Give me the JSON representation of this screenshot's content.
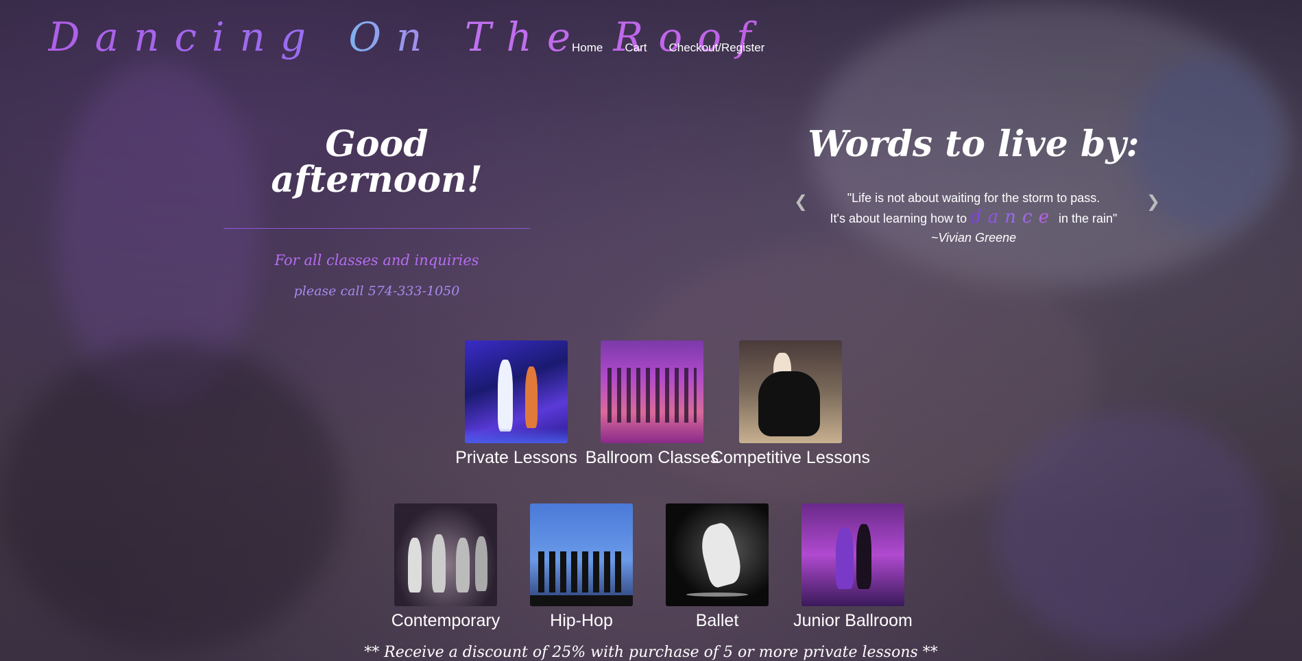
{
  "site": {
    "logo_text": "Dancing On The Roof"
  },
  "nav": {
    "items": [
      "Home",
      "Cart",
      "Checkout/Register"
    ]
  },
  "greeting": {
    "title": "Good afternoon!",
    "contact_line1": "For all classes and inquiries",
    "contact_line2": "please call 574-333-1050"
  },
  "quote": {
    "title": "Words to live by:",
    "line1": "\"Life is not about waiting for the storm to pass.",
    "line2_pre": "It's about learning how to",
    "dance_word": "dance",
    "line2_post": "in the rain\"",
    "author": "~Vivian Greene",
    "prev_icon": "chevron-left-icon",
    "next_icon": "chevron-right-icon"
  },
  "classes": {
    "row1": [
      "Private Lessons",
      "Ballroom Classes",
      "Competitive Lessons"
    ],
    "row2": [
      "Contemporary",
      "Hip-Hop",
      "Ballet",
      "Junior Ballroom"
    ]
  },
  "promo": {
    "text": "** Receive a discount of 25% with purchase of 5 or more private lessons **"
  },
  "colors": {
    "accent_purple": "#b56ef2",
    "rule": "#8a5ad6"
  }
}
